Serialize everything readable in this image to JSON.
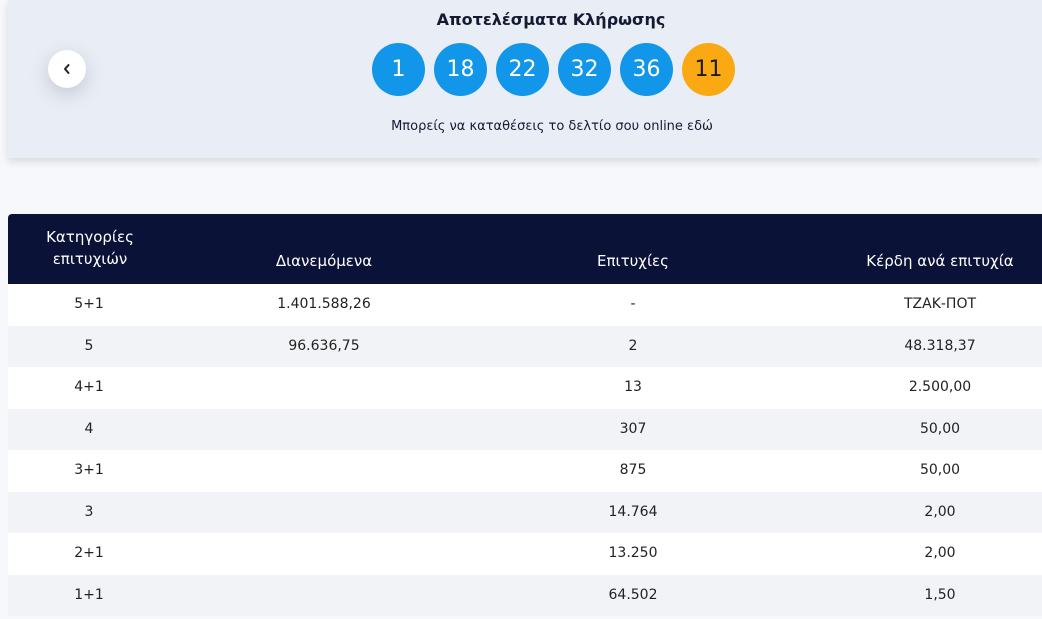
{
  "draw": {
    "title": "Αποτελέσματα Κλήρωσης",
    "numbers": [
      "1",
      "18",
      "22",
      "32",
      "36"
    ],
    "bonus": "11",
    "online_note": "Μπορείς να καταθέσεις το δελτίο σου online εδώ"
  },
  "table": {
    "headers": {
      "category_line1": "Κατηγορίες",
      "category_line2": "επιτυχιών",
      "distributed": "Διανεμόμενα",
      "successes": "Επιτυχίες",
      "winnings": "Κέρδη ανά επιτυχία"
    },
    "rows": [
      {
        "category": "5+1",
        "distributed": "1.401.588,26",
        "successes": "-",
        "winnings": "ΤΖΑΚ-ΠΟΤ"
      },
      {
        "category": "5",
        "distributed": "96.636,75",
        "successes": "2",
        "winnings": "48.318,37"
      },
      {
        "category": "4+1",
        "distributed": "",
        "successes": "13",
        "winnings": "2.500,00"
      },
      {
        "category": "4",
        "distributed": "",
        "successes": "307",
        "winnings": "50,00"
      },
      {
        "category": "3+1",
        "distributed": "",
        "successes": "875",
        "winnings": "50,00"
      },
      {
        "category": "3",
        "distributed": "",
        "successes": "14.764",
        "winnings": "2,00"
      },
      {
        "category": "2+1",
        "distributed": "",
        "successes": "13.250",
        "winnings": "2,00"
      },
      {
        "category": "1+1",
        "distributed": "",
        "successes": "64.502",
        "winnings": "1,50"
      }
    ]
  },
  "colors": {
    "main_ball": "#1196ea",
    "bonus_ball": "#fba913",
    "table_header": "#0b1237"
  }
}
